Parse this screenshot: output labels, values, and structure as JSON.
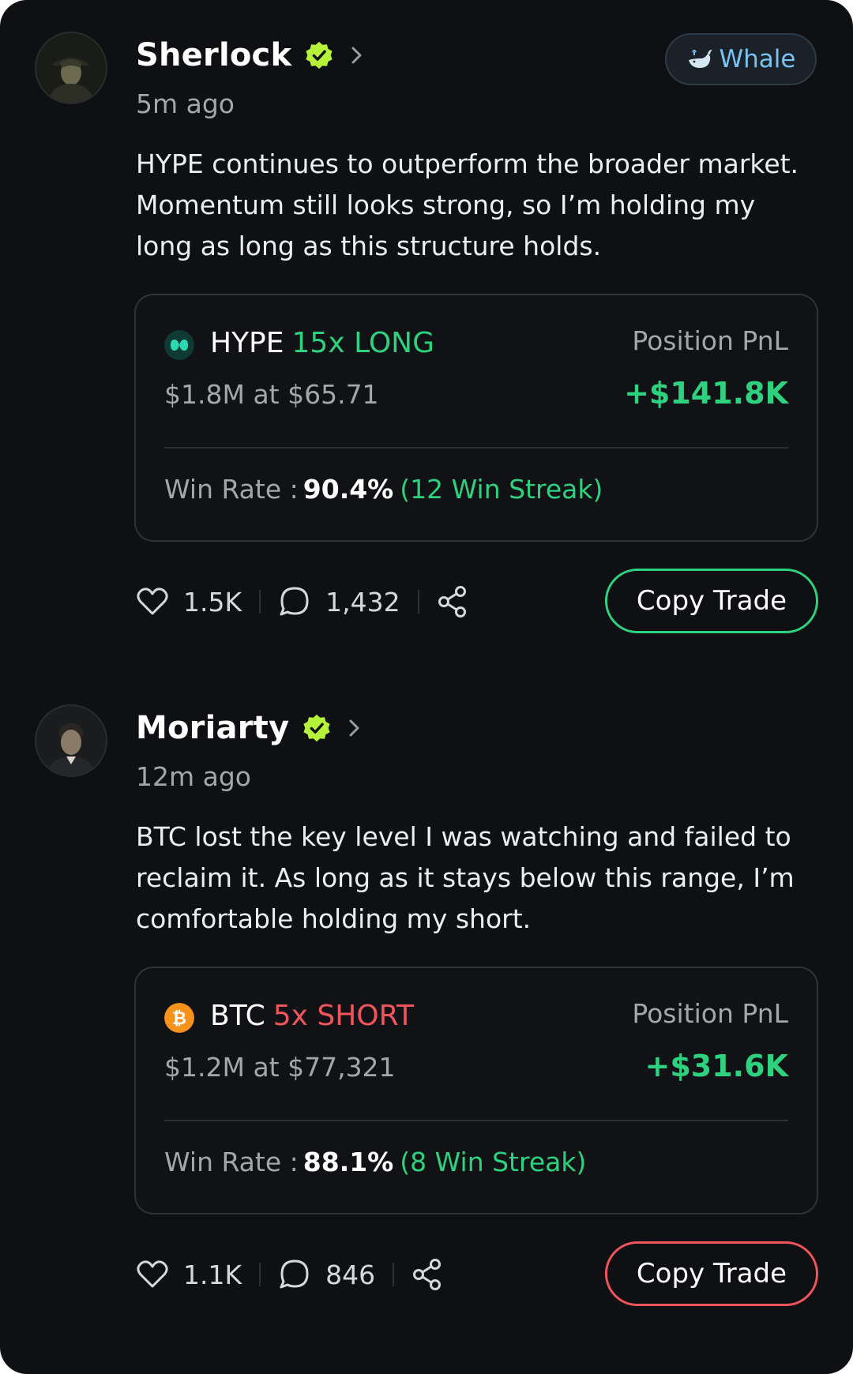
{
  "colors": {
    "background": "#0f1013",
    "long": "#2ed17e",
    "short": "#f2545b",
    "verified": "#b6f23a",
    "whale_tag": "#79c3f2",
    "hype_coin": "#2bd8b0",
    "btc_coin": "#f7931a"
  },
  "posts": [
    {
      "author": "Sherlock",
      "verified": true,
      "time": "5m ago",
      "tag": {
        "icon": "whale-icon",
        "label": "Whale"
      },
      "text_lines": [
        "HYPE continues to outperform the broader market.",
        "Momentum still looks strong, so I’m holding my",
        "long as long as this structure holds."
      ],
      "position": {
        "coin_icon": "hype-coin-icon",
        "asset": "HYPE",
        "direction": "15x LONG",
        "direction_type": "long",
        "size_text": "$1.8M at $65.71",
        "pnl_label": "Position PnL",
        "pnl": "+$141.8K",
        "win_rate_label": "Win Rate :",
        "win_rate": "90.4%",
        "streak": "(12 Win Streak)"
      },
      "likes": "1.5K",
      "comments": "1,432",
      "copy_label": "Copy Trade",
      "copy_color": "#2ed17e"
    },
    {
      "author": "Moriarty",
      "verified": true,
      "time": "12m ago",
      "text_lines": [
        "BTC lost the key level I was watching and failed to",
        "reclaim it. As long as it stays below this range, I’m",
        "comfortable holding my short."
      ],
      "position": {
        "coin_icon": "btc-coin-icon",
        "asset": "BTC",
        "direction": "5x SHORT",
        "direction_type": "short",
        "size_text": "$1.2M at $77,321",
        "pnl_label": "Position PnL",
        "pnl": "+$31.6K",
        "win_rate_label": "Win Rate :",
        "win_rate": "88.1%",
        "streak": "(8 Win Streak)"
      },
      "likes": "1.1K",
      "comments": "846",
      "copy_label": "Copy Trade",
      "copy_color": "#f2545b"
    }
  ]
}
